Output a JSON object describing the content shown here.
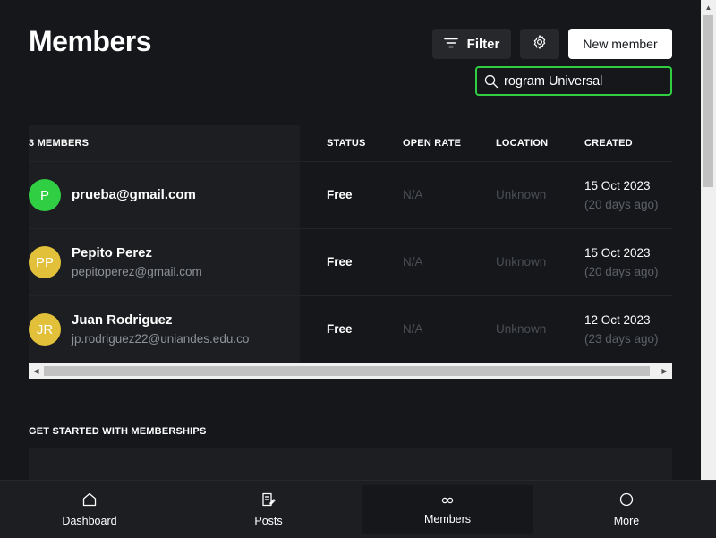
{
  "header": {
    "title": "Members",
    "filter_label": "Filter",
    "new_member_label": "New member"
  },
  "search": {
    "value": "rogram Universal"
  },
  "table": {
    "columns": [
      "3 MEMBERS",
      "STATUS",
      "OPEN RATE",
      "LOCATION",
      "CREATED"
    ],
    "rows": [
      {
        "initials": "P",
        "avatar_color": "#30cf43",
        "name": "prueba@gmail.com",
        "email": "",
        "status": "Free",
        "open_rate": "N/A",
        "location": "Unknown",
        "created": "15 Oct 2023",
        "ago": "(20 days ago)"
      },
      {
        "initials": "PP",
        "avatar_color": "#e2c03a",
        "name": "Pepito Perez",
        "email": "pepitoperez@gmail.com",
        "status": "Free",
        "open_rate": "N/A",
        "location": "Unknown",
        "created": "15 Oct 2023",
        "ago": "(20 days ago)"
      },
      {
        "initials": "JR",
        "avatar_color": "#e2c03a",
        "name": "Juan Rodriguez",
        "email": "jp.rodriguez22@uniandes.edu.co",
        "status": "Free",
        "open_rate": "N/A",
        "location": "Unknown",
        "created": "12 Oct 2023",
        "ago": "(23 days ago)"
      }
    ]
  },
  "memberships": {
    "title": "GET STARTED WITH MEMBERSHIPS"
  },
  "nav": {
    "items": [
      {
        "label": "Dashboard",
        "icon": "home-icon"
      },
      {
        "label": "Posts",
        "icon": "posts-icon"
      },
      {
        "label": "Members",
        "icon": "members-icon",
        "active": true
      },
      {
        "label": "More",
        "icon": "more-icon"
      }
    ]
  },
  "colors": {
    "background": "#15171a",
    "panel": "#1c1e21",
    "accent_green": "#30cf43",
    "avatar_yellow": "#e2c03a"
  }
}
